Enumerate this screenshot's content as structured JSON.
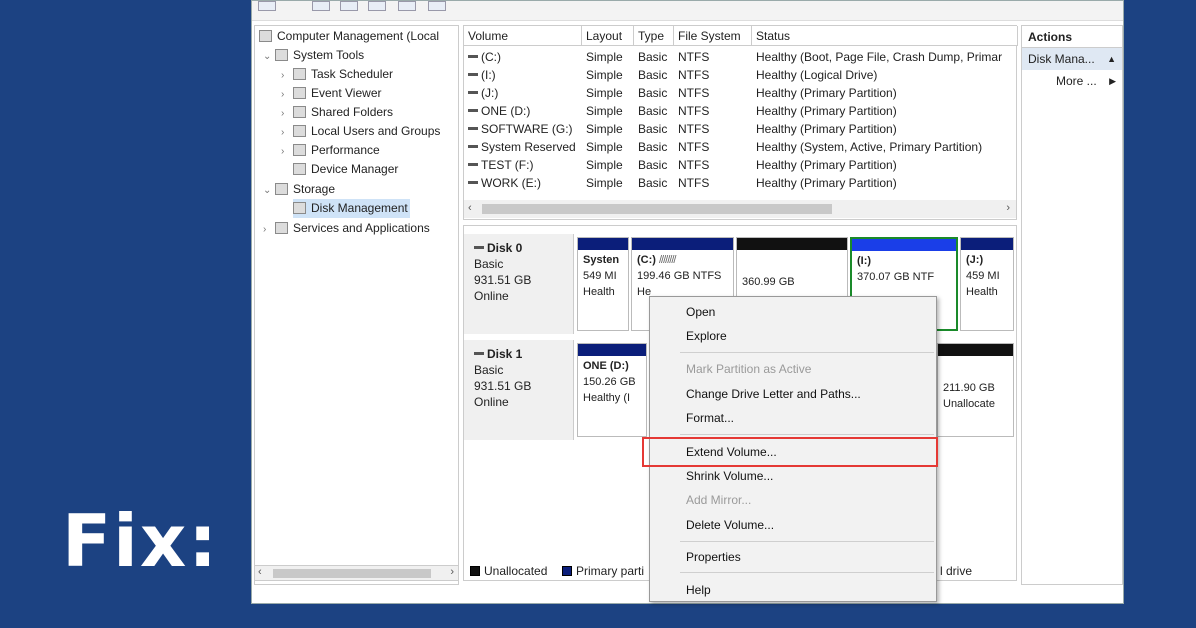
{
  "caption": "Fix:",
  "tree": {
    "items": [
      {
        "label": "Computer Management (Local"
      },
      {
        "label": "System Tools"
      },
      {
        "label": "Task Scheduler"
      },
      {
        "label": "Event Viewer"
      },
      {
        "label": "Shared Folders"
      },
      {
        "label": "Local Users and Groups"
      },
      {
        "label": "Performance"
      },
      {
        "label": "Device Manager"
      },
      {
        "label": "Storage"
      },
      {
        "label": "Disk Management"
      },
      {
        "label": "Services and Applications"
      }
    ]
  },
  "volumes": {
    "headers": [
      "Volume",
      "Layout",
      "Type",
      "File System",
      "Status"
    ],
    "rows": [
      [
        "(C:)",
        "Simple",
        "Basic",
        "NTFS",
        "Healthy (Boot, Page File, Crash Dump, Primar"
      ],
      [
        "(I:)",
        "Simple",
        "Basic",
        "NTFS",
        "Healthy (Logical Drive)"
      ],
      [
        "(J:)",
        "Simple",
        "Basic",
        "NTFS",
        "Healthy (Primary Partition)"
      ],
      [
        "ONE (D:)",
        "Simple",
        "Basic",
        "NTFS",
        "Healthy (Primary Partition)"
      ],
      [
        "SOFTWARE (G:)",
        "Simple",
        "Basic",
        "NTFS",
        "Healthy (Primary Partition)"
      ],
      [
        "System Reserved",
        "Simple",
        "Basic",
        "NTFS",
        "Healthy (System, Active, Primary Partition)"
      ],
      [
        "TEST (F:)",
        "Simple",
        "Basic",
        "NTFS",
        "Healthy (Primary Partition)"
      ],
      [
        "WORK (E:)",
        "Simple",
        "Basic",
        "NTFS",
        "Healthy (Primary Partition)"
      ]
    ]
  },
  "disks": [
    {
      "name": "Disk 0",
      "type": "Basic",
      "size": "931.51 GB",
      "state": "Online",
      "partitions": [
        {
          "l1": "Systen",
          "l2": "549 MI",
          "l3": "Health",
          "bar": "#0b1e7a"
        },
        {
          "l1": "(C:)",
          "l2": "199.46 GB NTFS",
          "l3": "He",
          "bar": "#0b1e7a"
        },
        {
          "l1": "",
          "l2": "360.99 GB",
          "l3": "",
          "bar": "#111111"
        },
        {
          "l1": "(I:)",
          "l2": "370.07 GB NTF",
          "l3": "",
          "bar": "#1a3ee8"
        },
        {
          "l1": "(J:)",
          "l2": "459 MI",
          "l3": "Health",
          "bar": "#0b1e7a"
        }
      ]
    },
    {
      "name": "Disk 1",
      "type": "Basic",
      "size": "931.51 GB",
      "state": "Online",
      "partitions": [
        {
          "l1": "ONE (D:)",
          "l2": "150.26 GB",
          "l3": "Healthy (I",
          "bar": "#0b1e7a"
        },
        {
          "l1": "",
          "l2": "211.90 GB",
          "l3": "Unallocate",
          "bar": "#111111"
        }
      ]
    }
  ],
  "legend": {
    "unallocated": "Unallocated",
    "primary": "Primary parti",
    "drive": "l drive"
  },
  "actions": {
    "title": "Actions",
    "item": "Disk Mana...",
    "more": "More ..."
  },
  "context_menu": {
    "open": "Open",
    "explore": "Explore",
    "mark_active": "Mark Partition as Active",
    "change_letter": "Change Drive Letter and Paths...",
    "format": "Format...",
    "extend": "Extend Volume...",
    "shrink": "Shrink Volume...",
    "add_mirror": "Add Mirror...",
    "delete": "Delete Volume...",
    "properties": "Properties",
    "help": "Help"
  },
  "colors": {
    "background": "#1c4282",
    "highlight_border": "#e53935",
    "selected_item": "#a9d0f5"
  }
}
